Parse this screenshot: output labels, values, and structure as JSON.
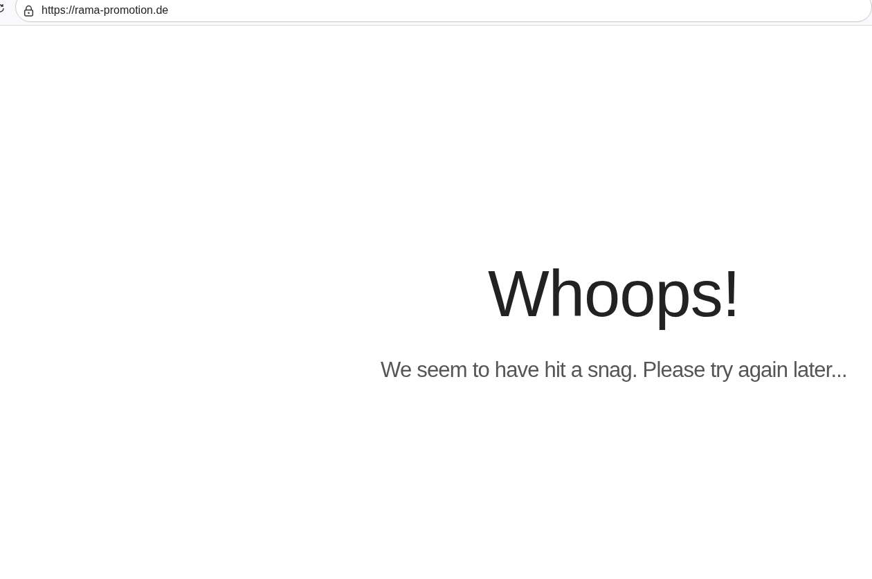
{
  "browser": {
    "url": "https://rama-promotion.de"
  },
  "page": {
    "heading": "Whoops!",
    "message": "We seem to have hit a snag. Please try again later..."
  }
}
